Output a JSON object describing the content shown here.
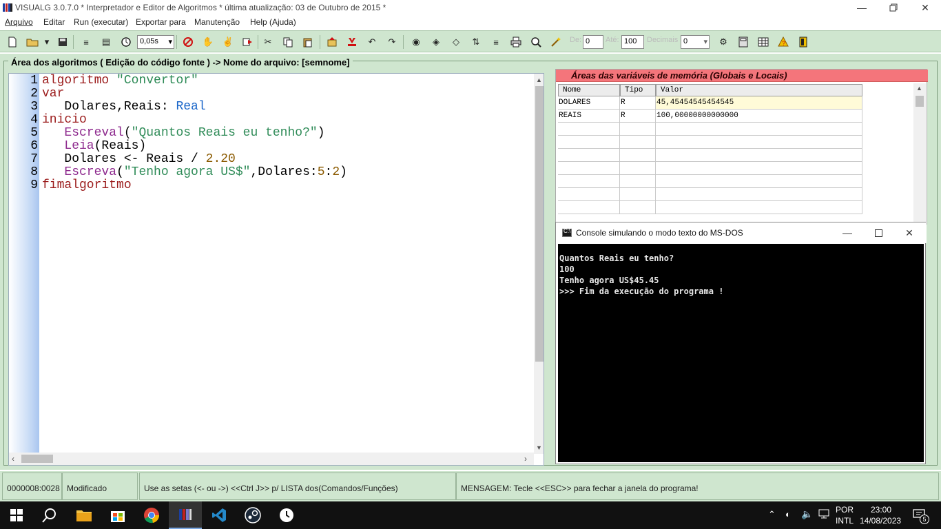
{
  "window": {
    "title": "VISUALG 3.0.7.0 * Interpretador e Editor de Algoritmos * última atualização: 03 de Outubro de 2015 *"
  },
  "menu": [
    "Arquivo",
    "Editar",
    "Run (executar)",
    "Exportar para",
    "Manutenção",
    "Help (Ajuda)"
  ],
  "toolbar": {
    "speed": "0,05s",
    "de_label": "De:",
    "de_value": "0",
    "ate_label": "Até:",
    "ate_value": "100",
    "decimais_label": "Decimais",
    "decimais_value": "0"
  },
  "editor": {
    "panel_title": "Área dos algoritmos ( Edição do código fonte ) -> Nome do arquivo: [semnome]",
    "line_numbers": [
      "1",
      "2",
      "3",
      "4",
      "5",
      "6",
      "7",
      "8",
      "9"
    ]
  },
  "variables": {
    "title": "Áreas das variáveis de memória (Globais e Locais)",
    "columns": [
      "Nome",
      "Tipo",
      "Valor"
    ],
    "rows": [
      {
        "nome": "DOLARES",
        "tipo": "R",
        "valor": "45,45454545454545"
      },
      {
        "nome": "REAIS",
        "tipo": "R",
        "valor": "100,00000000000000"
      }
    ]
  },
  "console": {
    "title": "Console simulando o modo texto do MS-DOS",
    "lines": [
      "Quantos Reais eu tenho?",
      "100",
      "Tenho agora US$45.45",
      ">>> Fim da execução do programa !"
    ]
  },
  "status": {
    "position": "0000008:0028",
    "state": "Modificado",
    "hint": "Use as setas (<- ou ->) <<Ctrl J>> p/ LISTA dos(Comandos/Funções)",
    "message": "MENSAGEM: Tecle <<ESC>> para fechar a janela do programa!"
  },
  "taskbar": {
    "lang1": "POR",
    "lang2": "INTL",
    "time": "23:00",
    "date": "14/08/2023",
    "notifications": "5"
  }
}
